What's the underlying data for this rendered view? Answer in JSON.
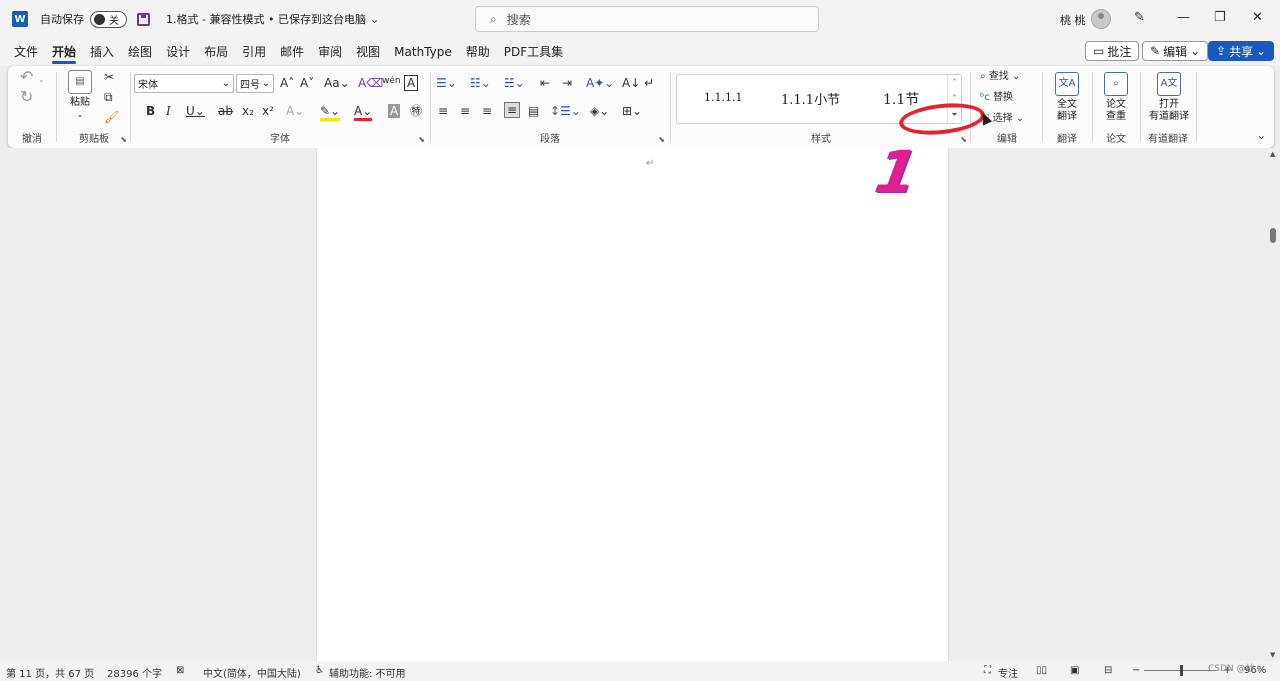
{
  "titlebar": {
    "app_icon": "W",
    "autosave_label": "自动保存",
    "autosave_state": "关",
    "doc_title": "1.格式 - 兼容性模式 • 已保存到这台电脑",
    "search_placeholder": "搜索",
    "user_name": "桃 桃",
    "icons": [
      "word-logo-icon",
      "save-icon",
      "search-icon",
      "avatar-icon",
      "pen-icon",
      "minimize-icon",
      "restore-icon",
      "close-icon"
    ]
  },
  "menubar": {
    "tabs": [
      "文件",
      "开始",
      "插入",
      "绘图",
      "设计",
      "布局",
      "引用",
      "邮件",
      "审阅",
      "视图",
      "MathType",
      "帮助",
      "PDF工具集"
    ],
    "active_tab": "开始",
    "comment_label": "批注",
    "edit_label": "编辑",
    "share_label": "共享"
  },
  "ribbon": {
    "groups": {
      "undo": "撤消",
      "clipboard": "剪贴板",
      "font": "字体",
      "paragraph": "段落",
      "styles": "样式",
      "editing": "编辑",
      "translate": "翻译",
      "paper": "论文",
      "youdao": "有道翻译"
    },
    "paste_label": "粘贴",
    "font_name": "宋体",
    "font_size": "四号",
    "style_items": [
      "1.1.1.1",
      "1.1.1小节",
      "1.1节"
    ],
    "find_label": "查找",
    "replace_label": "替换",
    "select_label": "选择",
    "translate_btn": [
      "全文",
      "翻译"
    ],
    "paper_btn": [
      "论文",
      "查重"
    ],
    "youdao_btn": [
      "打开",
      "有道翻译"
    ]
  },
  "annotation": {
    "number": "1",
    "color": "#e8212e"
  },
  "statusbar": {
    "page": "第 11 页，共 67 页",
    "words": "28396 个字",
    "language": "中文(简体，中国大陆)",
    "accessibility": "辅助功能: 不可用",
    "focus": "专注",
    "zoom": "96%",
    "watermark": "CSDN @纱..."
  },
  "colors": {
    "accent": "#185abd",
    "annotation_red": "#e8212e",
    "annotation_pink": "#e0208f"
  }
}
